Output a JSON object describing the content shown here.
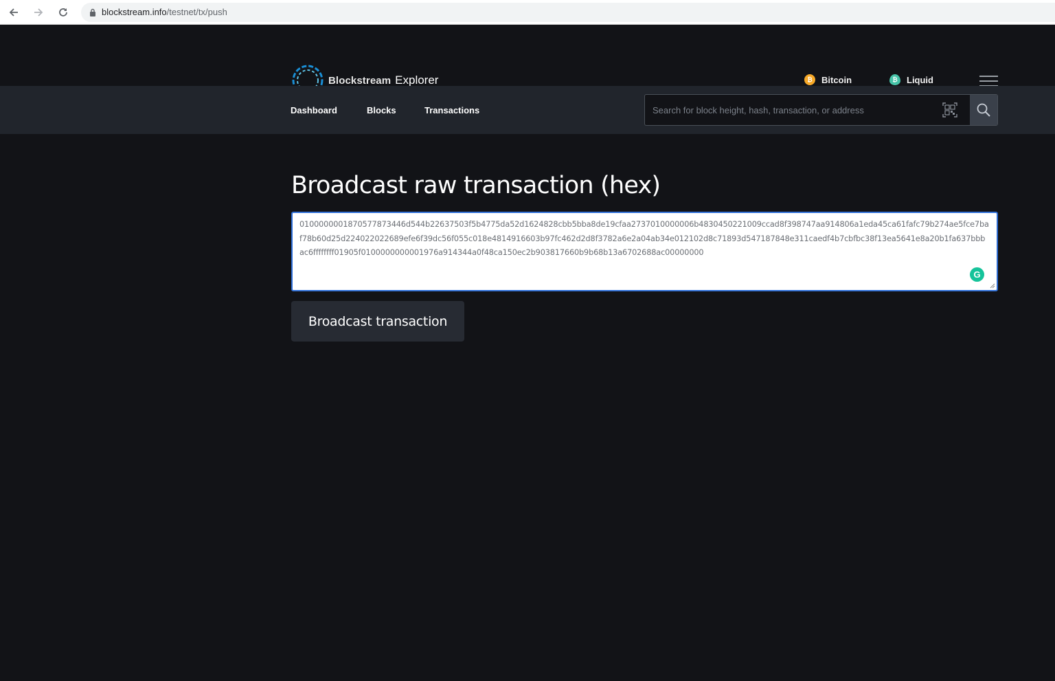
{
  "browser": {
    "url_domain": "blockstream.info",
    "url_path": "/testnet/tx/push",
    "icons": [
      "back-arrow",
      "forward-arrow",
      "reload",
      "lock"
    ]
  },
  "header": {
    "logo_word1": "Blockstream",
    "logo_word2": "Explorer",
    "networks": [
      {
        "label": "Bitcoin",
        "icon": "bitcoin-coin",
        "color": "#f7a928"
      },
      {
        "label": "Liquid",
        "icon": "liquid-drop",
        "color": "#46c3a8"
      }
    ]
  },
  "subnav": {
    "links": [
      {
        "label": "Dashboard"
      },
      {
        "label": "Blocks"
      },
      {
        "label": "Transactions"
      }
    ],
    "search_placeholder": "Search for block height, hash, transaction, or address",
    "search_value": ""
  },
  "main": {
    "title": "Broadcast raw transaction (hex)",
    "raw_tx_hex": "0100000001870577873446d544b22637503f5b4775da52d1624828cbb5bba8de19cfaa2737010000006b4830450221009ccad8f398747aa914806a1eda45ca61fafc79b274ae5fce7baf78b60d25d224022022689efe6f39dc56f055c018e4814916603b97fc462d2d8f3782a6e2a04ab34e012102d8c71893d547187848e311caedf4b7cbfbc38f13ea5641e8a20b1fa637bbbac6ffffffff01905f0100000000001976a914344a0f48ca150ec2b903817660b9b68b13a6702688ac00000000",
    "broadcast_button": "Broadcast transaction"
  },
  "colors": {
    "background": "#121317",
    "subnav": "#21252c",
    "focus_border": "#2f6fd8",
    "button": "#272b33"
  }
}
